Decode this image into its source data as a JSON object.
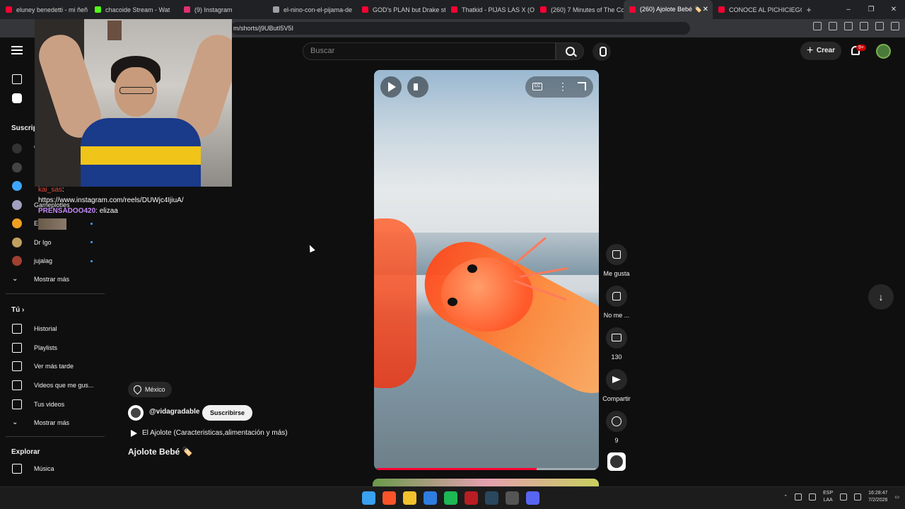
{
  "browser": {
    "tabs": [
      {
        "label": "eluney benedetti - mi ñeñ",
        "color": "#ff0033"
      },
      {
        "label": "chacoide Stream - Wat",
        "color": "#53fc18"
      },
      {
        "label": "(9) Instagram",
        "color": "#e1306c"
      },
      {
        "label": "el-nino-con-el-pijama-de",
        "color": "#9aa0a6"
      },
      {
        "label": "GOD's PLAN but Drake st",
        "color": "#ff0033"
      },
      {
        "label": "Thatkid - PIJAS LAS X (Offi",
        "color": "#ff0033"
      },
      {
        "label": "(260) 7 Minutes of The Co",
        "color": "#ff0033"
      },
      {
        "label": "(260) Ajolote Bebé 🏷️",
        "color": "#ff0033",
        "active": true
      },
      {
        "label": "CONOCE AL PICHICIEGO",
        "color": "#ff0033"
      }
    ],
    "new_tab": "+",
    "url": "m/shorts/j9UButI5V5I",
    "window_controls": [
      "–",
      "❐",
      "✕"
    ]
  },
  "header": {
    "search_placeholder": "Buscar",
    "create_label": "Crear",
    "notifications_badge": "9+"
  },
  "sidebar": {
    "subscriptions_heading": "Suscrip",
    "subscriptions": [
      {
        "label": "W",
        "color": "#333333"
      },
      {
        "label": "",
        "color": "#444444"
      },
      {
        "label": "",
        "color": "#3ea6ff"
      },
      {
        "label": "Gameplotles",
        "color": "#a0a0c0"
      },
      {
        "label": "E",
        "color": "#f0a020"
      },
      {
        "label": "Dr Igo",
        "color": "#c0a060"
      },
      {
        "label": "jujalag",
        "color": "#a04030"
      }
    ],
    "show_more_1": "Mostrar más",
    "you_heading": "Tú",
    "you_items": [
      {
        "label": "Historial",
        "icon": "history-icon"
      },
      {
        "label": "Playlists",
        "icon": "playlists-icon"
      },
      {
        "label": "Ver más tarde",
        "icon": "watch-later-icon"
      },
      {
        "label": "Videos que me gus...",
        "icon": "liked-icon"
      },
      {
        "label": "Tus videos",
        "icon": "your-videos-icon"
      }
    ],
    "show_more_2": "Mostrar más",
    "explore_heading": "Explorar",
    "explore_items": [
      {
        "label": "Música",
        "icon": "music-icon"
      }
    ]
  },
  "chat": {
    "msg1_user": "kai_sas",
    "msg1_text": ": https://www.instagram.com/reels/DUWjc4IjiuA/",
    "msg2_user": "PRENSADOO420",
    "msg2_text": ": elizaa"
  },
  "video": {
    "progress": 0.73,
    "actions": {
      "like_label": "Me gusta",
      "dislike_label": "No me ...",
      "comments_count": "130",
      "share_label": "Compartir",
      "remix_count": "9"
    },
    "location": "México",
    "channel": "@vidagradable",
    "subscribe_label": "Suscribirse",
    "playlist": "El Ajolote (Caracteristicas,alimentación y más)",
    "title": "Ajolote Bebé 🏷️"
  },
  "taskbar": {
    "apps": [
      {
        "icon": "windows-icon",
        "color": "#3aa0f0"
      },
      {
        "icon": "brave-icon",
        "color": "#fb542b"
      },
      {
        "icon": "files-icon",
        "color": "#f2c12e"
      },
      {
        "icon": "bing-icon",
        "color": "#2f7de1"
      },
      {
        "icon": "spotify-icon",
        "color": "#1db954"
      },
      {
        "icon": "netflix-icon",
        "color": "#b81d24"
      },
      {
        "icon": "steam-icon",
        "color": "#2a475e"
      },
      {
        "icon": "settings-icon",
        "color": "#555555"
      },
      {
        "icon": "discord-icon",
        "color": "#5865f2"
      }
    ],
    "lang_1": "ESP",
    "lang_2": "LAA",
    "time": "16:28:47",
    "date": "7/2/2026"
  }
}
